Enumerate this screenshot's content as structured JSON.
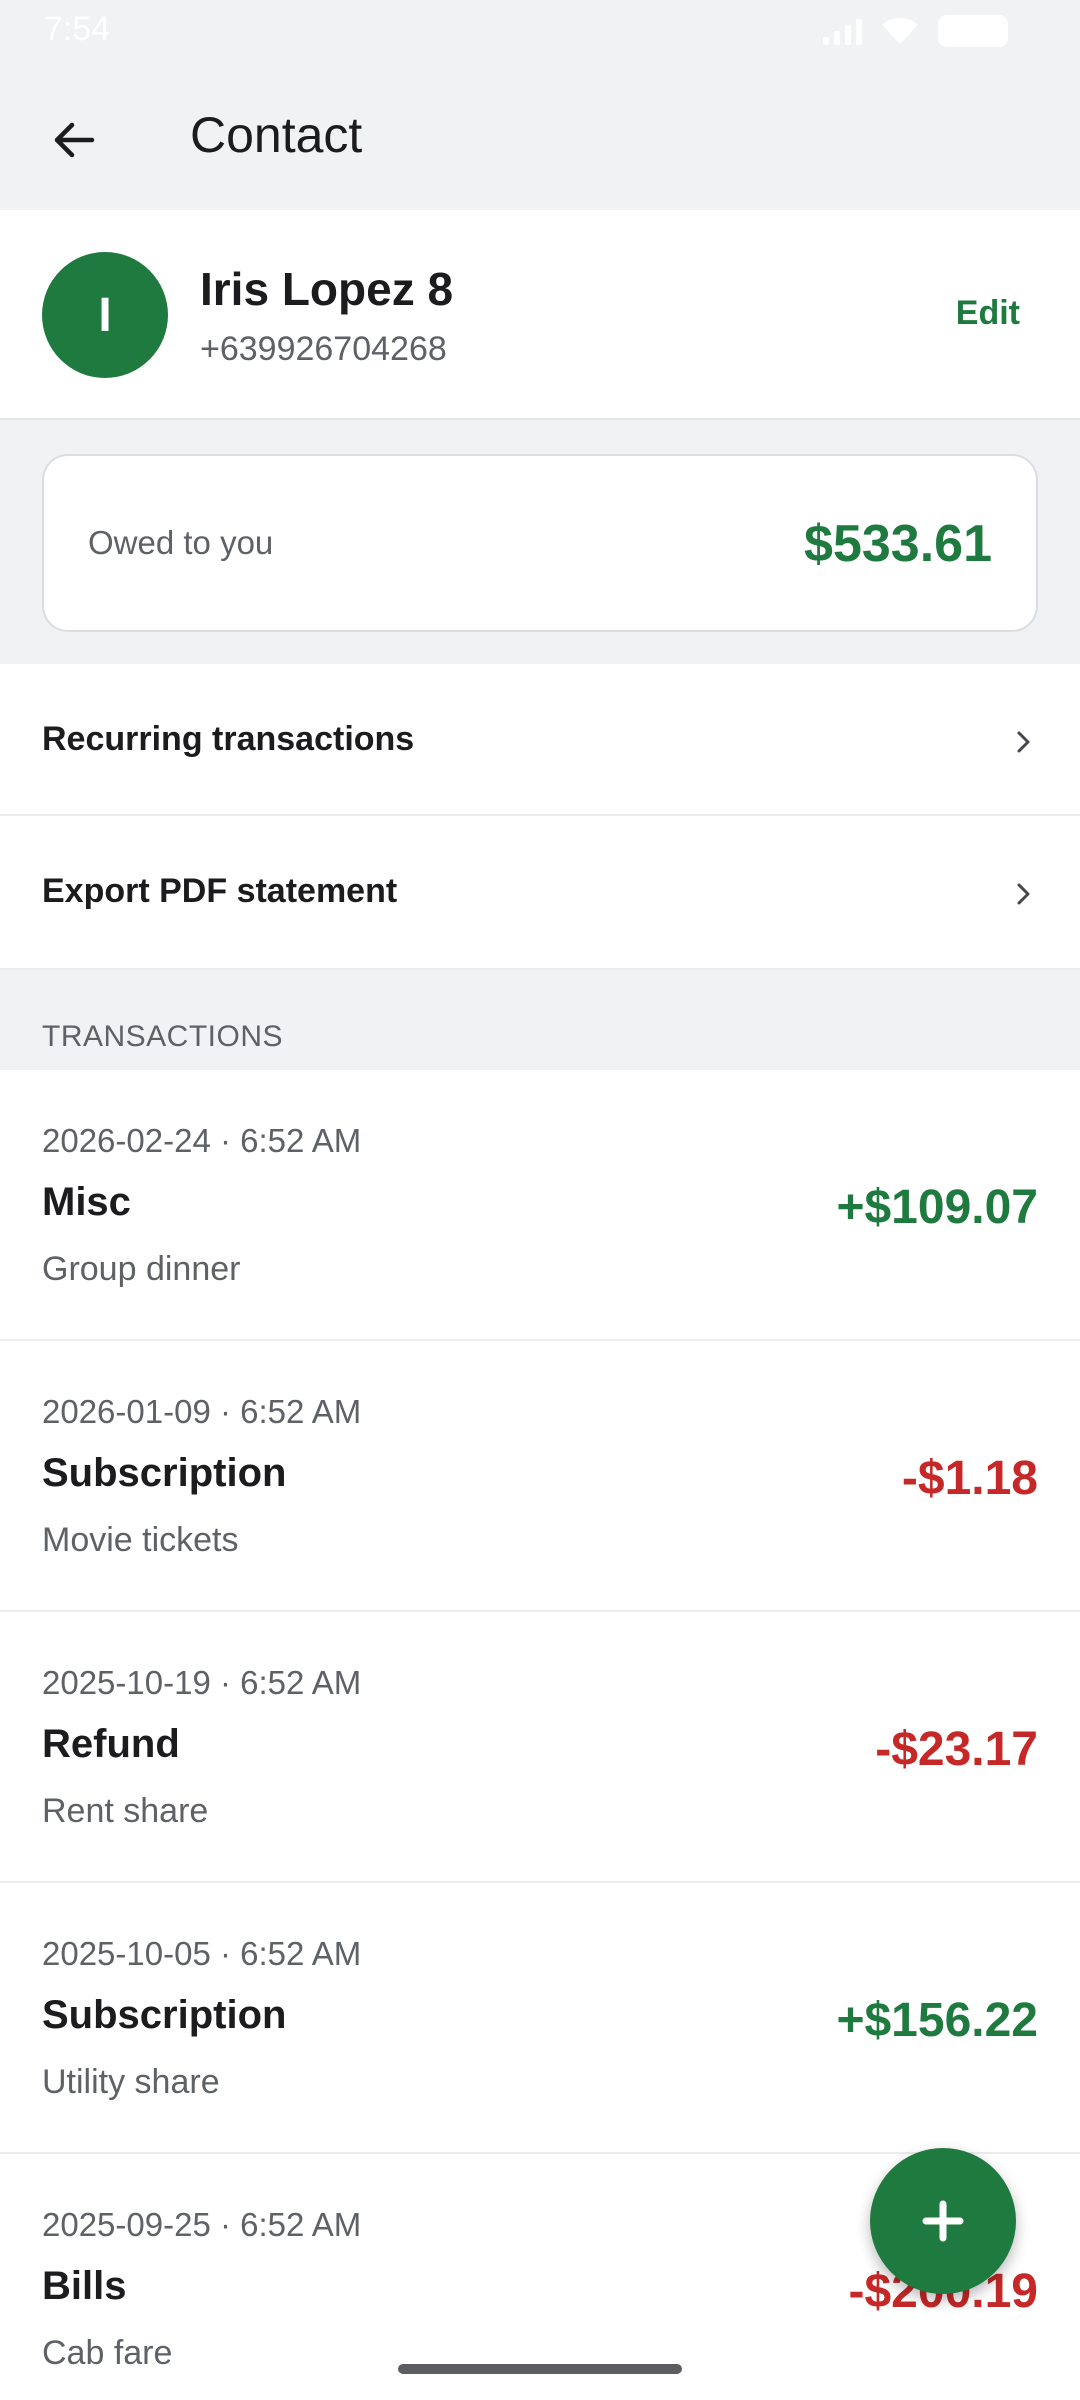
{
  "status_bar": {
    "time": "7:54"
  },
  "app_bar": {
    "title": "Contact",
    "back_icon": "arrow-left-icon"
  },
  "contact": {
    "initial": "I",
    "name": "Iris Lopez 8",
    "phone": "+639926704268",
    "edit_label": "Edit"
  },
  "balance": {
    "label": "Owed to you",
    "amount": "$533.61"
  },
  "menu": {
    "recurring_label": "Recurring transactions",
    "export_label": "Export PDF statement"
  },
  "transactions": {
    "section_title": "TRANSACTIONS",
    "items": [
      {
        "date": "2026-02-24 · 6:52 AM",
        "category": "Misc",
        "note": "Group dinner",
        "amount": "+$109.07",
        "positive": true
      },
      {
        "date": "2026-01-09 · 6:52 AM",
        "category": "Subscription",
        "note": "Movie tickets",
        "amount": "-$1.18",
        "positive": false
      },
      {
        "date": "2025-10-19 · 6:52 AM",
        "category": "Refund",
        "note": "Rent share",
        "amount": "-$23.17",
        "positive": false
      },
      {
        "date": "2025-10-05 · 6:52 AM",
        "category": "Subscription",
        "note": "Utility share",
        "amount": "+$156.22",
        "positive": true
      },
      {
        "date": "2025-09-25 · 6:52 AM",
        "category": "Bills",
        "note": "Cab fare",
        "amount": "-$200.19",
        "positive": false
      }
    ]
  },
  "colors": {
    "accent": "#1f7a3f",
    "positive": "#1f7a3f",
    "negative": "#c62828"
  },
  "fab": {
    "icon": "plus-icon"
  }
}
